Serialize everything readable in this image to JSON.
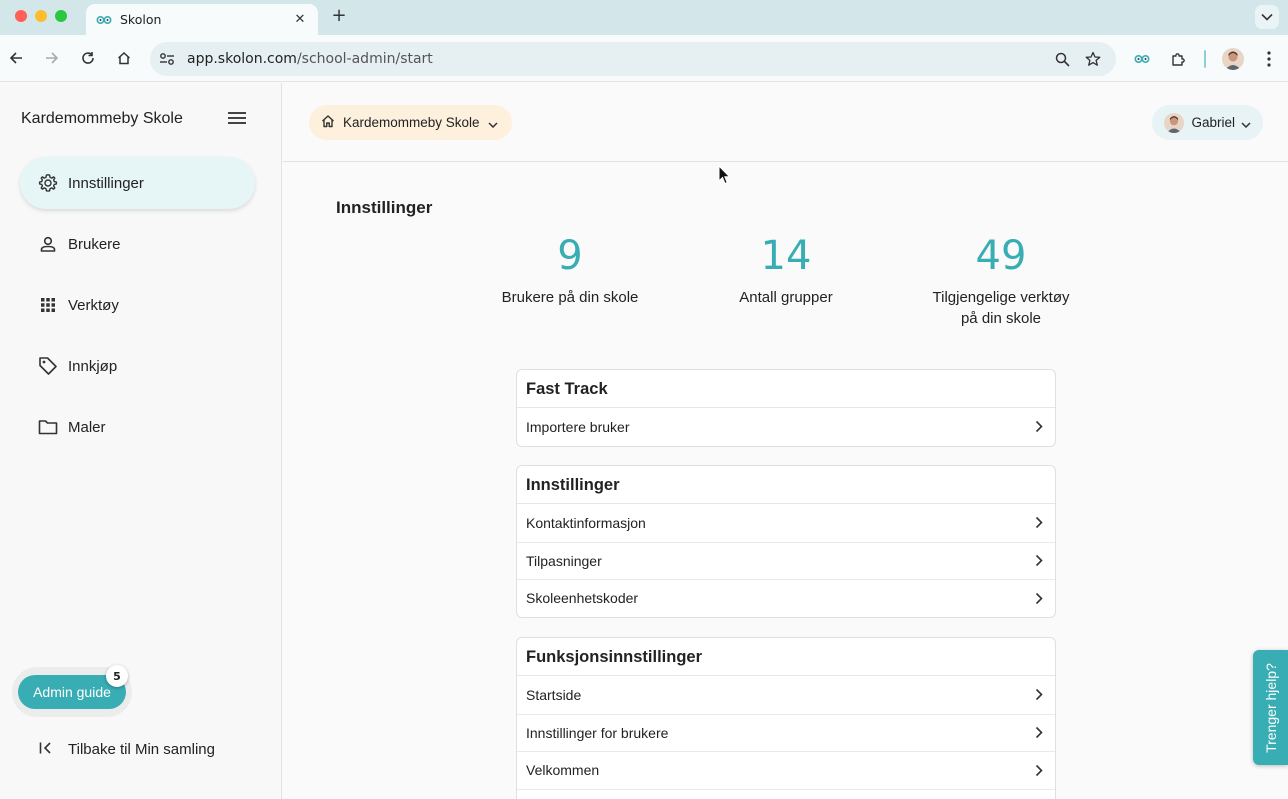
{
  "browser": {
    "tab_title": "Skolon",
    "new_tab": "+",
    "url_host": "app.skolon.com",
    "url_path": "/school-admin/start"
  },
  "sidebar": {
    "school_name": "Kardemommeby Skole",
    "items": [
      {
        "label": "Innstillinger",
        "icon": "gear-icon",
        "active": true
      },
      {
        "label": "Brukere",
        "icon": "person-icon",
        "active": false
      },
      {
        "label": "Verktøy",
        "icon": "apps-grid-icon",
        "active": false
      },
      {
        "label": "Innkjøp",
        "icon": "tag-icon",
        "active": false
      },
      {
        "label": "Maler",
        "icon": "folder-icon",
        "active": false
      }
    ],
    "admin_guide_label": "Admin guide",
    "admin_guide_badge": "5",
    "back_label": "Tilbake til Min samling"
  },
  "topbar": {
    "school_select": "Kardemommeby Skole",
    "user_name": "Gabriel"
  },
  "main": {
    "title": "Innstillinger",
    "stats": [
      {
        "value": "9",
        "label": "Brukere på din skole"
      },
      {
        "value": "14",
        "label": "Antall grupper"
      },
      {
        "value": "49",
        "label": "Tilgjengelige verktøy på din skole"
      }
    ],
    "cards": [
      {
        "title": "Fast Track",
        "rows": [
          "Importere bruker"
        ]
      },
      {
        "title": "Innstillinger",
        "rows": [
          "Kontaktinformasjon",
          "Tilpasninger",
          "Skoleenhetskoder"
        ]
      },
      {
        "title": "Funksjonsinnstillinger",
        "rows": [
          "Startside",
          "Innstillinger for brukere",
          "Velkommen"
        ]
      }
    ]
  },
  "help_tab": "Trenger hjelp?",
  "colors": {
    "accent": "#38adb3",
    "school_select_bg": "#fdf0dc",
    "active_nav_bg": "#e6f5f6"
  }
}
